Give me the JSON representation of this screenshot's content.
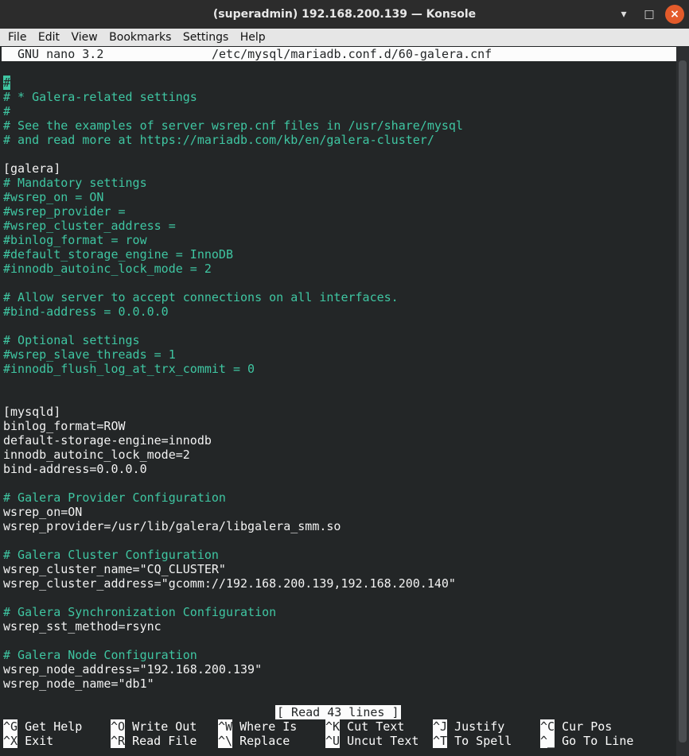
{
  "window": {
    "title": "(superadmin) 192.168.200.139 — Konsole",
    "buttons": {
      "minimize": "▾",
      "maximize": "□",
      "close": "×"
    }
  },
  "menu": [
    "File",
    "Edit",
    "View",
    "Bookmarks",
    "Settings",
    "Help"
  ],
  "nano": {
    "version": "GNU nano 3.2",
    "filepath": "/etc/mysql/mariadb.conf.d/60-galera.cnf",
    "status": "[ Read 43 lines ]"
  },
  "file_lines": [
    "#",
    "# * Galera-related settings",
    "#",
    "# See the examples of server wsrep.cnf files in /usr/share/mysql",
    "# and read more at https://mariadb.com/kb/en/galera-cluster/",
    "",
    "[galera]",
    "# Mandatory settings",
    "#wsrep_on = ON",
    "#wsrep_provider =",
    "#wsrep_cluster_address =",
    "#binlog_format = row",
    "#default_storage_engine = InnoDB",
    "#innodb_autoinc_lock_mode = 2",
    "",
    "# Allow server to accept connections on all interfaces.",
    "#bind-address = 0.0.0.0",
    "",
    "# Optional settings",
    "#wsrep_slave_threads = 1",
    "#innodb_flush_log_at_trx_commit = 0",
    "",
    "",
    "[mysqld]",
    "binlog_format=ROW",
    "default-storage-engine=innodb",
    "innodb_autoinc_lock_mode=2",
    "bind-address=0.0.0.0",
    "",
    "# Galera Provider Configuration",
    "wsrep_on=ON",
    "wsrep_provider=/usr/lib/galera/libgalera_smm.so",
    "",
    "# Galera Cluster Configuration",
    "wsrep_cluster_name=\"CQ_CLUSTER\"",
    "wsrep_cluster_address=\"gcomm://192.168.200.139,192.168.200.140\"",
    "",
    "# Galera Synchronization Configuration",
    "wsrep_sst_method=rsync",
    "",
    "# Galera Node Configuration",
    "wsrep_node_address=\"192.168.200.139\"",
    "wsrep_node_name=\"db1\""
  ],
  "shortcuts": [
    [
      {
        "key": "^G",
        "label": "Get Help"
      },
      {
        "key": "^O",
        "label": "Write Out"
      },
      {
        "key": "^W",
        "label": "Where Is"
      },
      {
        "key": "^K",
        "label": "Cut Text"
      },
      {
        "key": "^J",
        "label": "Justify"
      },
      {
        "key": "^C",
        "label": "Cur Pos"
      }
    ],
    [
      {
        "key": "^X",
        "label": "Exit"
      },
      {
        "key": "^R",
        "label": "Read File"
      },
      {
        "key": "^\\",
        "label": "Replace"
      },
      {
        "key": "^U",
        "label": "Uncut Text"
      },
      {
        "key": "^T",
        "label": "To Spell"
      },
      {
        "key": "^_",
        "label": "Go To Line"
      }
    ]
  ],
  "colors": {
    "comment": "#3fc6a2",
    "background": "#232627",
    "text": "#fcfcfc"
  }
}
